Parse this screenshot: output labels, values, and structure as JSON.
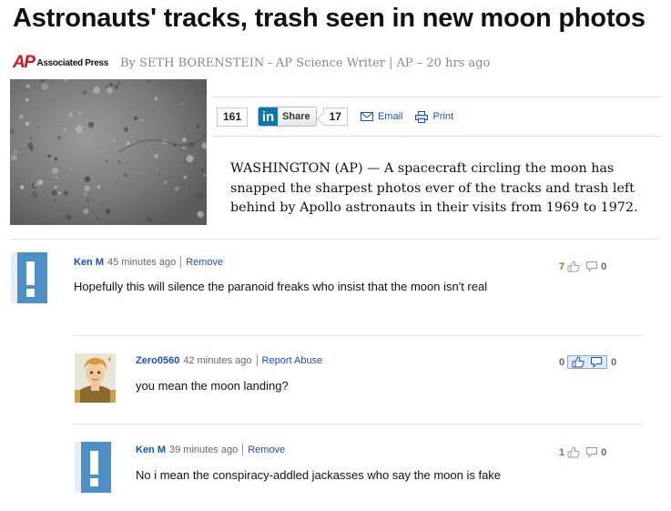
{
  "article": {
    "headline": "Astronauts' tracks, trash seen in new moon photos",
    "source_logo_mark": "AP",
    "source_logo_name": "Associated Press",
    "byline_author": "By SETH BORENSTEIN - AP Science Writer",
    "byline_outlet": "| AP – 20 hrs ago",
    "lede": "WASHINGTON (AP) — A spacecraft circling the moon has snapped the sharpest photos ever of the tracks and trash left behind by Apollo astronauts in their visits from 1969 to 1972."
  },
  "share_bar": {
    "facebook_count": "161",
    "linkedin_logo": "in",
    "linkedin_label": "Share",
    "linkedin_count": "17",
    "email_label": "Email",
    "print_label": "Print"
  },
  "comments": [
    {
      "user": "Ken M",
      "time": "45 minutes ago",
      "action": "Remove",
      "text": "Hopefully this will silence the paranoid freaks who insist that the moon isn't real",
      "thumbs_up": "7",
      "thumbs_down": "0"
    },
    {
      "user": "Zero0560",
      "time": "42 minutes ago",
      "action": "Report Abuse",
      "text": "you mean the moon landing?",
      "thumbs_up": "0",
      "thumbs_down": "0"
    },
    {
      "user": "Ken M",
      "time": "39 minutes ago",
      "action": "Remove",
      "text": "No i mean the conspiracy-addled jackasses who say the moon is fake",
      "thumbs_up": "1",
      "thumbs_down": "0"
    }
  ],
  "icons": {
    "default_avatar": "placeholder-avatar-icon",
    "user_avatar": "cartoon-avatar-icon",
    "thumbs_up": "thumbs-up-icon",
    "thumbs_down": "thumbs-down-icon",
    "email": "envelope-icon",
    "print": "printer-icon"
  },
  "colors": {
    "link_blue": "#1a4fb3",
    "ap_red": "#d5161b",
    "linkedin_blue": "#0e76a8",
    "avatar_blue": "#4f8fc8",
    "upvote_green": "#3c9b2a"
  }
}
